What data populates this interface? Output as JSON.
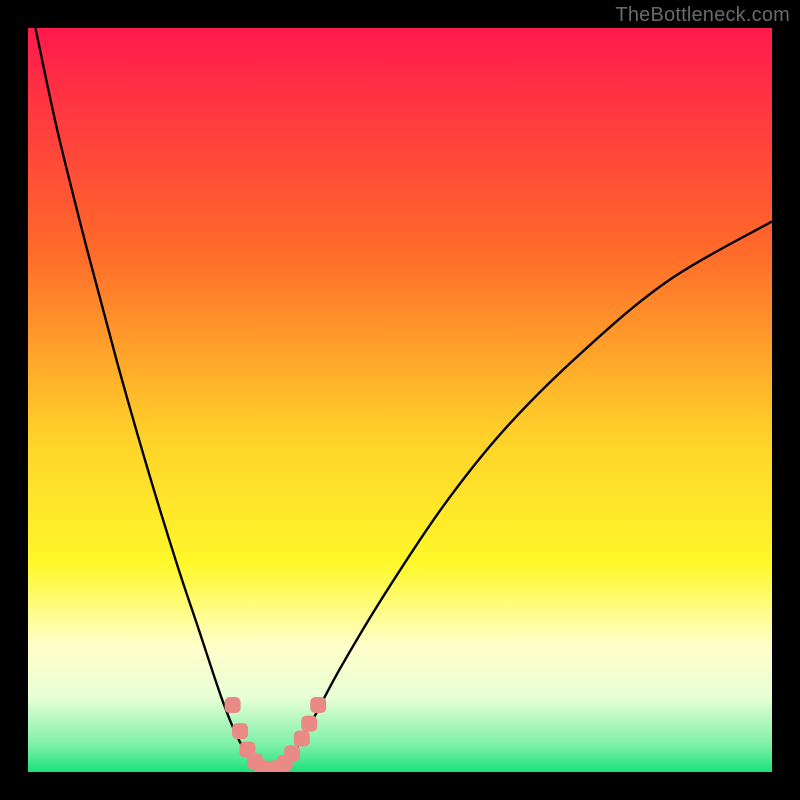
{
  "attribution": "TheBottleneck.com",
  "colors": {
    "black": "#000000",
    "curve": "#000000",
    "markers": "#e98a84",
    "gradient_top": "#ff1a4d",
    "gradient_mid_upper": "#ff8a2a",
    "gradient_mid": "#ffe82a",
    "gradient_light": "#ffffc9",
    "gradient_bottom": "#1ae27a"
  },
  "chart_data": {
    "type": "line",
    "title": "",
    "xlabel": "",
    "ylabel": "",
    "xlim": [
      0,
      100
    ],
    "ylim": [
      0,
      100
    ],
    "x_optimum": 32,
    "curve": {
      "x": [
        1,
        4,
        8,
        12,
        16,
        20,
        23,
        26,
        28,
        30,
        31,
        32,
        33,
        34,
        35,
        36,
        38,
        42,
        48,
        56,
        64,
        74,
        86,
        100
      ],
      "y": [
        100,
        86,
        70,
        55,
        41,
        28,
        19,
        10,
        5,
        1.5,
        0.6,
        0.2,
        0.2,
        0.6,
        1.5,
        3,
        6.5,
        14,
        24,
        36,
        46,
        56,
        66,
        74
      ]
    },
    "markers": {
      "x": [
        27.5,
        28.5,
        29.5,
        30.5,
        31.5,
        32.5,
        33.5,
        34.5,
        35.5,
        36.8,
        37.8,
        39.0
      ],
      "y": [
        9.0,
        5.5,
        3.0,
        1.4,
        0.5,
        0.4,
        0.5,
        1.2,
        2.5,
        4.5,
        6.5,
        9.0
      ]
    },
    "gradient_stops": [
      {
        "offset": 0.0,
        "color": "#ff1a4d"
      },
      {
        "offset": 0.3,
        "color": "#ff6a2a"
      },
      {
        "offset": 0.55,
        "color": "#ffd22a"
      },
      {
        "offset": 0.72,
        "color": "#fff82a"
      },
      {
        "offset": 0.83,
        "color": "#ffffc9"
      },
      {
        "offset": 0.9,
        "color": "#e8ffd6"
      },
      {
        "offset": 0.965,
        "color": "#7af0a6"
      },
      {
        "offset": 1.0,
        "color": "#1ae27a"
      }
    ]
  }
}
